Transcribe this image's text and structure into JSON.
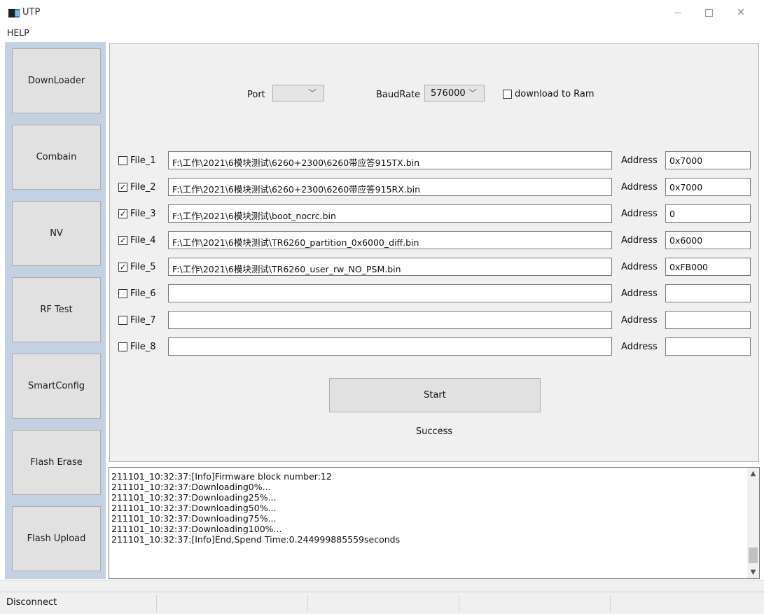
{
  "window": {
    "title": "UTP"
  },
  "menu": {
    "help": "HELP"
  },
  "sidebar": {
    "items": [
      {
        "label": "DownLoader"
      },
      {
        "label": "Combain"
      },
      {
        "label": "NV"
      },
      {
        "label": "RF Test"
      },
      {
        "label": "SmartConfig"
      },
      {
        "label": "Flash Erase"
      },
      {
        "label": "Flash Upload"
      }
    ]
  },
  "settings": {
    "port_label": "Port",
    "port_value": "",
    "baud_label": "BaudRate",
    "baud_value": "576000",
    "ram_label": "download to Ram",
    "ram_checked": false
  },
  "files": [
    {
      "label": "File_1",
      "checked": false,
      "path": "F:\\工作\\2021\\6模块测试\\6260+2300\\6260带应答915TX.bin",
      "address_label": "Address",
      "address": "0x7000"
    },
    {
      "label": "File_2",
      "checked": true,
      "path": "F:\\工作\\2021\\6模块测试\\6260+2300\\6260带应答915RX.bin",
      "address_label": "Address",
      "address": "0x7000"
    },
    {
      "label": "File_3",
      "checked": true,
      "path": "F:\\工作\\2021\\6模块测试\\boot_nocrc.bin",
      "address_label": "Address",
      "address": "0"
    },
    {
      "label": "File_4",
      "checked": true,
      "path": "F:\\工作\\2021\\6模块测试\\TR6260_partition_0x6000_diff.bin",
      "address_label": "Address",
      "address": "0x6000"
    },
    {
      "label": "File_5",
      "checked": true,
      "path": "F:\\工作\\2021\\6模块测试\\TR6260_user_rw_NO_PSM.bin",
      "address_label": "Address",
      "address": "0xFB000"
    },
    {
      "label": "File_6",
      "checked": false,
      "path": "",
      "address_label": "Address",
      "address": ""
    },
    {
      "label": "File_7",
      "checked": false,
      "path": "",
      "address_label": "Address",
      "address": ""
    },
    {
      "label": "File_8",
      "checked": false,
      "path": "",
      "address_label": "Address",
      "address": ""
    }
  ],
  "actions": {
    "start_label": "Start",
    "status": "Success"
  },
  "log": {
    "lines": [
      "211101_10:32:37:[Info]Firmware block number:12",
      "211101_10:32:37:Downloading0%...",
      "211101_10:32:37:Downloading25%...",
      "211101_10:32:37:Downloading50%...",
      "211101_10:32:37:Downloading75%...",
      "211101_10:32:37:Downloading100%...",
      "211101_10:32:37:[Info]End,Spend Time:0.244999885559seconds"
    ]
  },
  "statusbar": {
    "connection": "Disconnect"
  },
  "icons": {
    "chevron": "chevron-down-icon",
    "check": "check-icon",
    "minimize": "minimize-icon",
    "maximize": "maximize-icon",
    "close": "close-icon"
  }
}
